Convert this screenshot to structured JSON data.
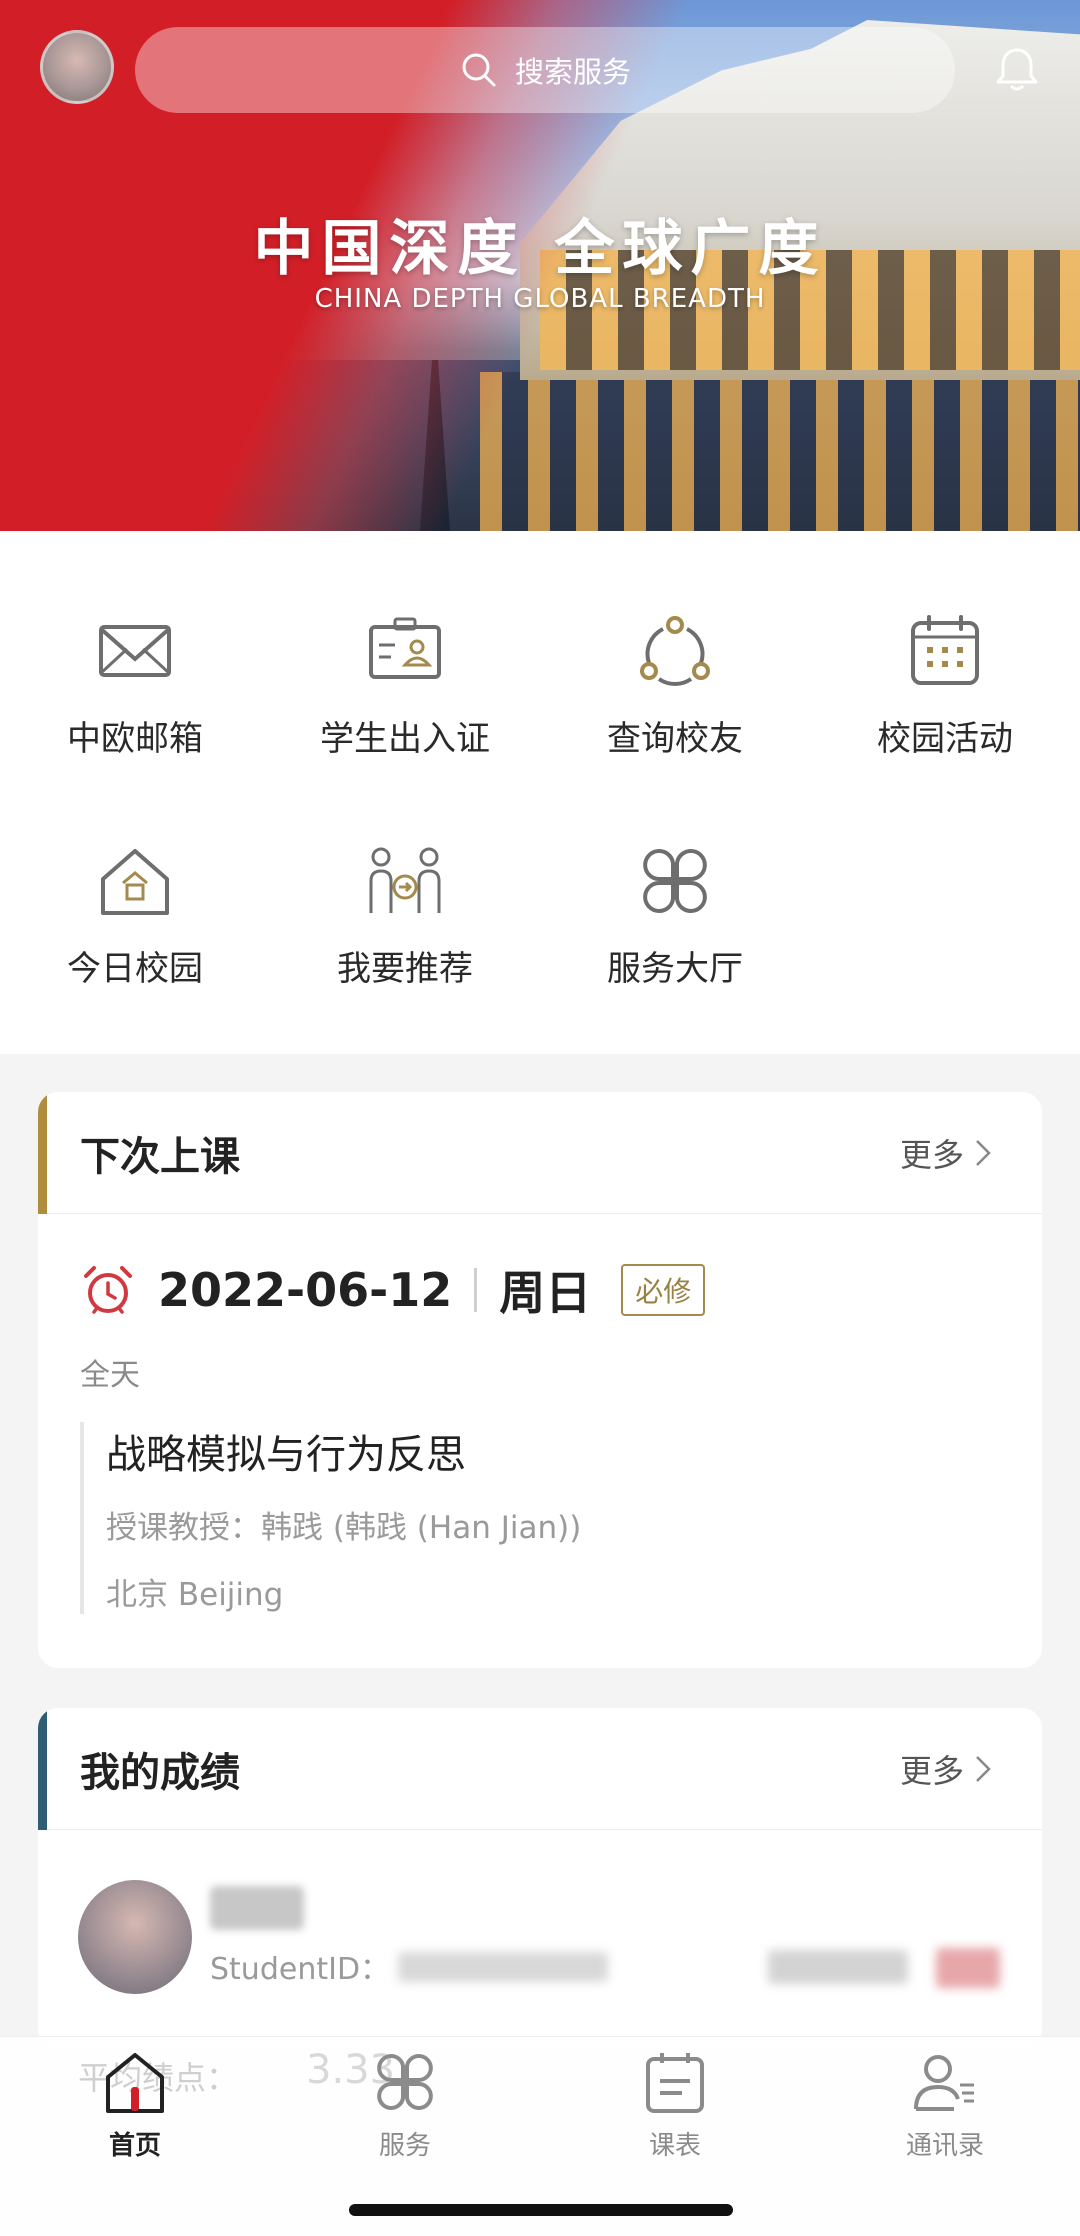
{
  "banner": {
    "slogan_cn": "中国深度  全球广度",
    "slogan_en": "CHINA DEPTH    GLOBAL BREADTH"
  },
  "search": {
    "placeholder": "搜索服务",
    "icon": "search-icon"
  },
  "header": {
    "bell_icon": "bell-icon"
  },
  "quick_services": [
    {
      "label": "中欧邮箱",
      "icon": "mail-icon"
    },
    {
      "label": "学生出入证",
      "icon": "id-card-icon"
    },
    {
      "label": "查询校友",
      "icon": "alumni-network-icon"
    },
    {
      "label": "校园活动",
      "icon": "calendar-icon"
    },
    {
      "label": "今日校园",
      "icon": "campus-home-icon"
    },
    {
      "label": "我要推荐",
      "icon": "recommend-icon"
    },
    {
      "label": "服务大厅",
      "icon": "service-hall-icon"
    }
  ],
  "next_class": {
    "title": "下次上课",
    "more_label": "更多",
    "date": "2022-06-12",
    "weekday": "周日",
    "tag": "必修",
    "time": "全天",
    "course_name": "战略模拟与行为反思",
    "teacher": "授课教授：韩践 (韩践 (Han Jian))",
    "location": "北京 Beijing"
  },
  "grades": {
    "title": "我的成绩",
    "more_label": "更多",
    "student_id_label": "StudentID：",
    "gpa_label_partial": "平均绩点：",
    "gpa_value_partial": "3.33"
  },
  "tabbar": [
    {
      "label": "首页",
      "icon": "home-icon",
      "active": true
    },
    {
      "label": "服务",
      "icon": "service-icon",
      "active": false
    },
    {
      "label": "课表",
      "icon": "schedule-icon",
      "active": false
    },
    {
      "label": "通讯录",
      "icon": "contacts-icon",
      "active": false
    }
  ],
  "colors": {
    "brand_red": "#d21f27",
    "gold": "#a48a4c",
    "card_bar_next": "#b08d3c",
    "card_bar_grades": "#2f5d74"
  }
}
